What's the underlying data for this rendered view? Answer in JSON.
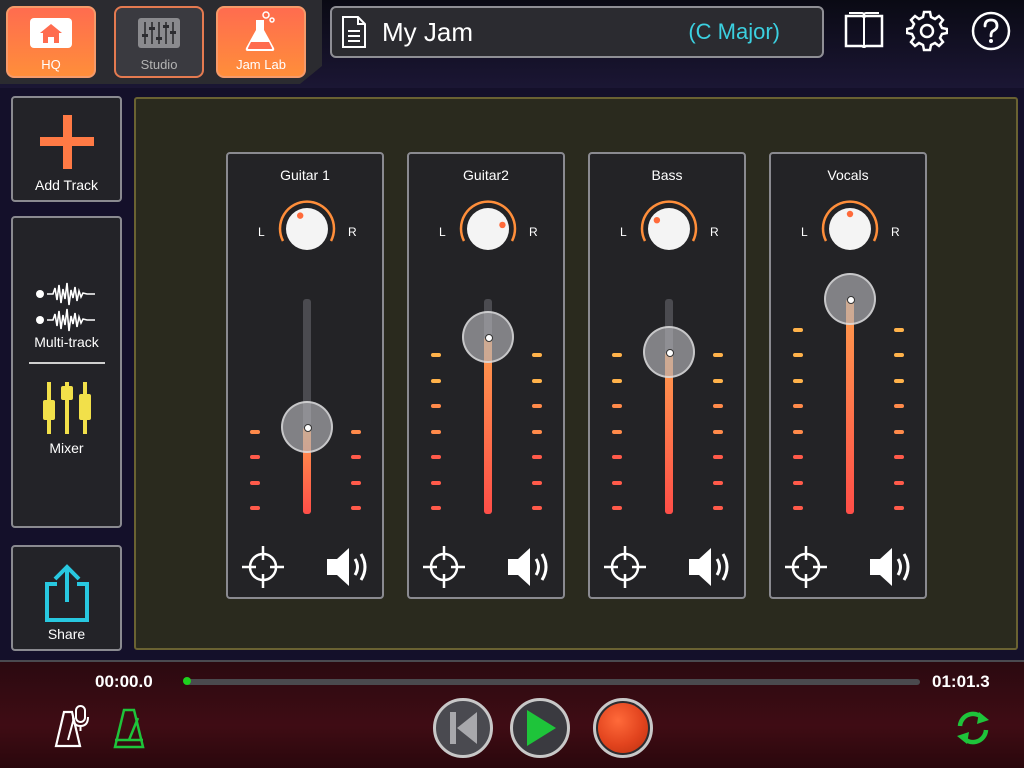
{
  "nav": {
    "hq_label": "HQ",
    "studio_label": "Studio",
    "jamlab_label": "Jam Lab"
  },
  "title": {
    "name": "My Jam",
    "key": "(C Major)"
  },
  "top_icons": [
    "book-icon",
    "gear-icon",
    "help-icon"
  ],
  "sidebar": {
    "add_track_label": "Add Track",
    "multitrack_label": "Multi-track",
    "mixer_label": "Mixer",
    "share_label": "Share"
  },
  "pan": {
    "left_label": "L",
    "right_label": "R"
  },
  "channels": [
    {
      "name": "Guitar 1",
      "pan": -0.2,
      "level": 0.4
    },
    {
      "name": "Guitar2",
      "pan": 0.55,
      "level": 0.82
    },
    {
      "name": "Bass",
      "pan": -0.4,
      "level": 0.75
    },
    {
      "name": "Vocals",
      "pan": 0.0,
      "level": 1.0
    }
  ],
  "transport": {
    "time_start": "00:00.0",
    "time_end": "01:01.3",
    "progress": 0.0
  },
  "colors": {
    "accent_orange": "#ff8e3a",
    "key_cyan": "#3bd0e0",
    "play_green": "#1ec43a",
    "record_red": "#e2441e",
    "meter_top": "#ff9c4d",
    "meter_bottom": "#ff4e48",
    "mixer_yellow": "#f2e04a",
    "share_cyan": "#28c8e0"
  }
}
